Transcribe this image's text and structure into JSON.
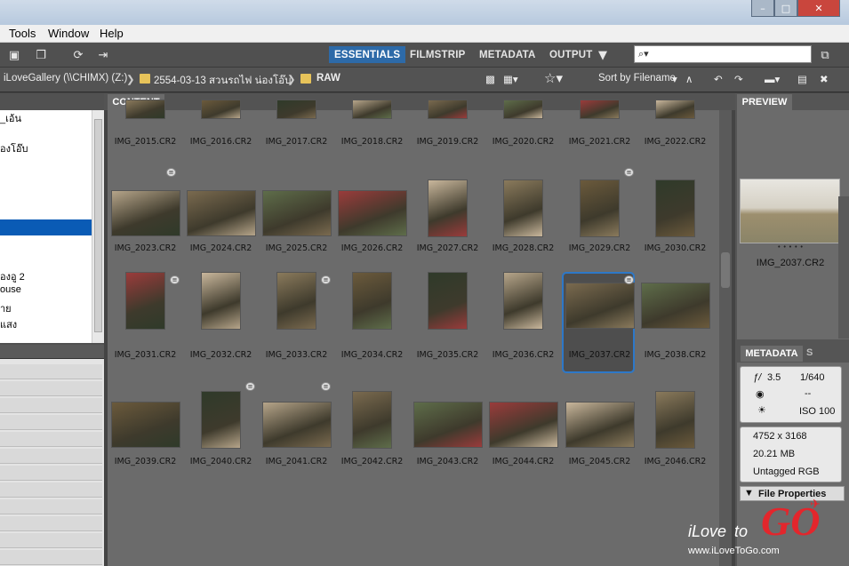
{
  "menu": {
    "tools": "Tools",
    "window": "Window",
    "help": "Help"
  },
  "workspaces": {
    "essentials": "ESSENTIALS",
    "filmstrip": "FILMSTRIP",
    "metadata": "METADATA",
    "output": "OUTPUT"
  },
  "search": {
    "placeholder": "⌕▾"
  },
  "path": {
    "drive": "iLoveGallery (\\\\CHIMX) (Z:)",
    "folder": "2554-03-13 สวนรถไฟ น่องโอ๊บ",
    "sub": "RAW"
  },
  "sort": {
    "label": "Sort by Filename"
  },
  "folders": [
    "ุ_เอ้น",
    "่องโอ๊บ",
    "องอู 2",
    "ouse",
    "าย",
    "แสง"
  ],
  "tabs": {
    "content": "CONTENT",
    "preview": "PREVIEW",
    "metadata": "METADATA",
    "keywords_tail": "S"
  },
  "rows": [
    [
      "IMG_2015.CR2",
      "IMG_2016.CR2",
      "IMG_2017.CR2",
      "IMG_2018.CR2",
      "IMG_2019.CR2",
      "IMG_2020.CR2",
      "IMG_2021.CR2",
      "IMG_2022.CR2"
    ],
    [
      "IMG_2023.CR2",
      "IMG_2024.CR2",
      "IMG_2025.CR2",
      "IMG_2026.CR2",
      "IMG_2027.CR2",
      "IMG_2028.CR2",
      "IMG_2029.CR2",
      "IMG_2030.CR2"
    ],
    [
      "IMG_2031.CR2",
      "IMG_2032.CR2",
      "IMG_2033.CR2",
      "IMG_2034.CR2",
      "IMG_2035.CR2",
      "IMG_2036.CR2",
      "IMG_2037.CR2",
      "IMG_2038.CR2"
    ],
    [
      "IMG_2039.CR2",
      "IMG_2040.CR2",
      "IMG_2041.CR2",
      "IMG_2042.CR2",
      "IMG_2043.CR2",
      "IMG_2044.CR2",
      "IMG_2045.CR2",
      "IMG_2046.CR2"
    ]
  ],
  "preview": {
    "filename": "IMG_2037.CR2",
    "dots": "• • • • •"
  },
  "metadata": {
    "aperture": "3.5",
    "shutter": "1/640",
    "metering": "--",
    "exposure": "--",
    "iso": "ISO 100",
    "dimensions": "4752 x 3168",
    "size": "20.21 MB",
    "color": "Untagged RGB",
    "section": "File Properties"
  },
  "watermark": {
    "brand_a": "iLove",
    "brand_b": "to",
    "brand_c": "GO",
    "url": "www.iLoveToGo.com"
  }
}
